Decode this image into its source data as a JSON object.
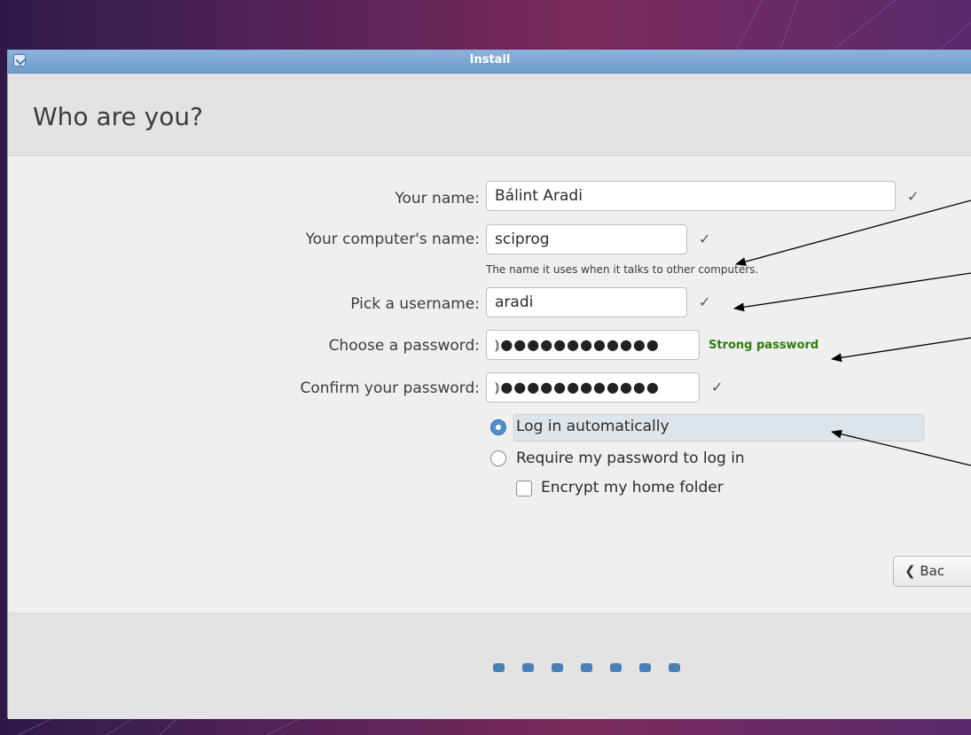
{
  "window": {
    "title": "Install"
  },
  "header": {
    "title": "Who are you?"
  },
  "form": {
    "name_label": "Your name:",
    "name_value": "Bálint Aradi",
    "computer_label": "Your computer's name:",
    "computer_value": "sciprog",
    "computer_hint": "The name it uses when it talks to other computers.",
    "username_label": "Pick a username:",
    "username_value": "aradi",
    "password_label": "Choose a password:",
    "password_value": "⦆●●●●●●●●●●●●",
    "password_strength": "Strong password",
    "confirm_label": "Confirm your password:",
    "confirm_value": "⦆●●●●●●●●●●●●",
    "check_symbol": "✓",
    "login_auto_label": "Log in automatically",
    "login_password_label": "Require my password to log in",
    "encrypt_label": "Encrypt my home folder"
  },
  "state": {
    "login_mode": "automatic",
    "encrypt_home": false
  },
  "buttons": {
    "back_label": "❮ Bac"
  },
  "progress": {
    "total_steps": 7
  },
  "colors": {
    "accent": "#4d8fd1",
    "strong": "#2f7d11",
    "titlebar": "#7aa4d1",
    "progress_dot": "#4b7fb8"
  }
}
